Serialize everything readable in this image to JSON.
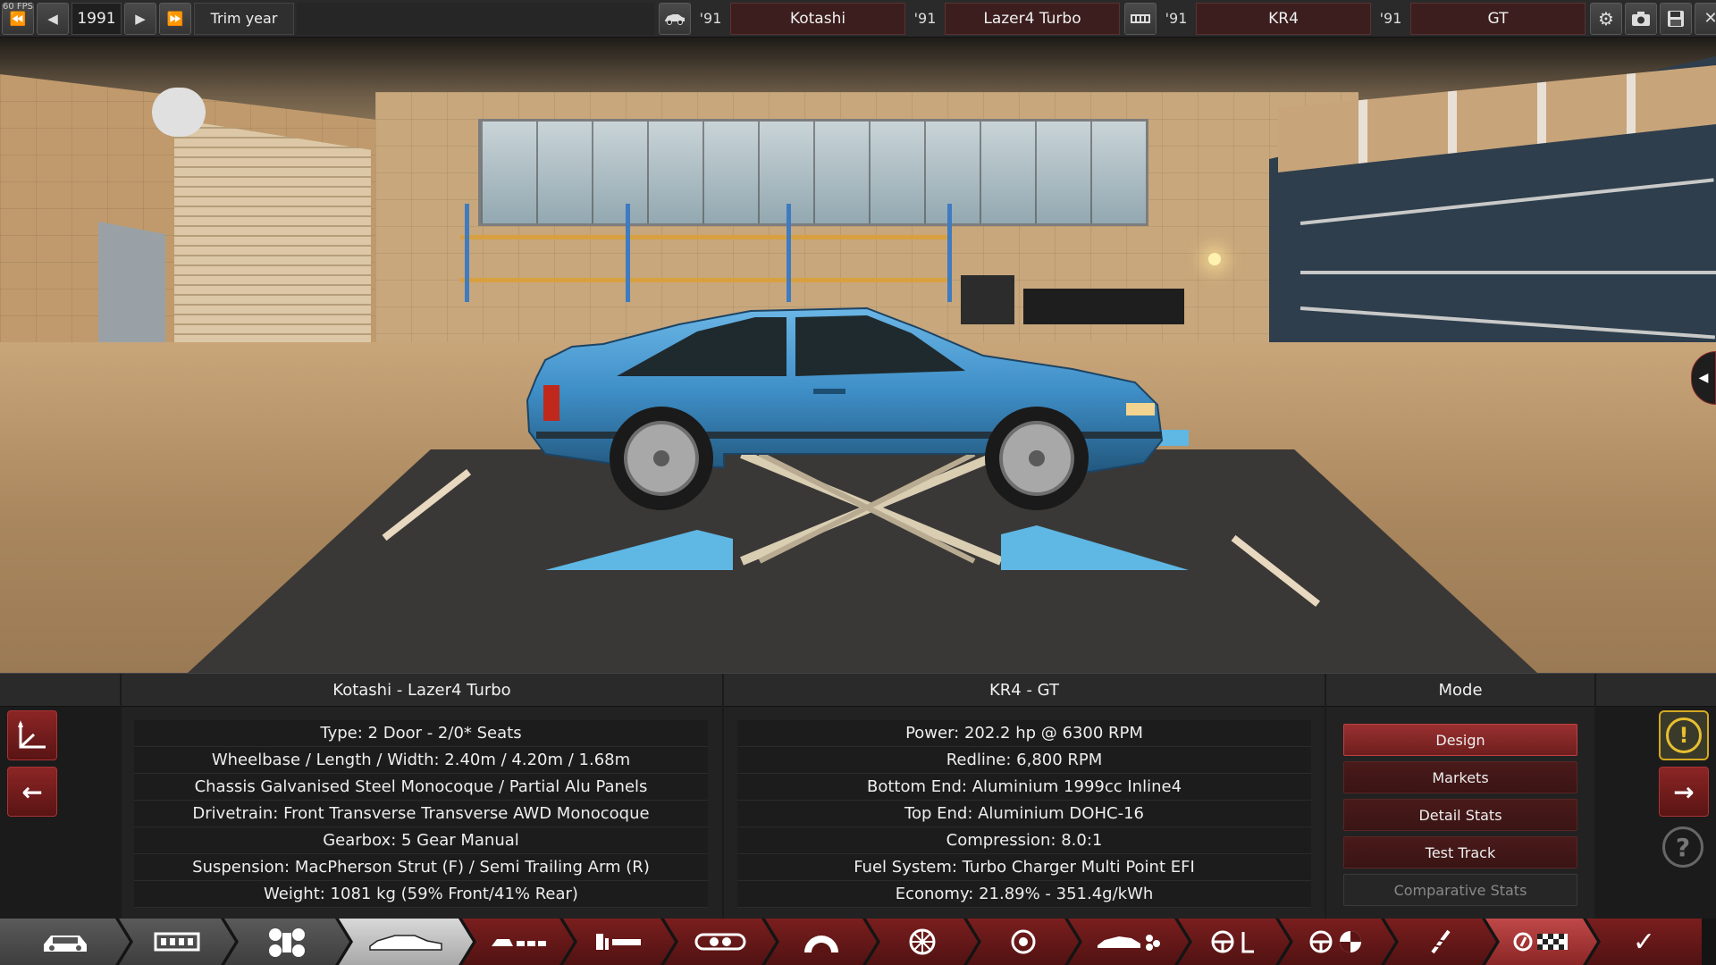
{
  "topbar": {
    "fps": "60 FPS",
    "year": "1991",
    "trim_year_label": "Trim year",
    "model_year_1": "'91",
    "model_family": "Kotashi",
    "model_year_2": "'91",
    "model_name": "Lazer4 Turbo",
    "engine_year_1": "'91",
    "engine_family": "KR4",
    "engine_year_2": "'91",
    "engine_variant": "GT"
  },
  "panel": {
    "car_header": "Kotashi - Lazer4 Turbo",
    "engine_header": "KR4 - GT",
    "mode_header": "Mode",
    "car_rows": [
      "Type: 2 Door - 2/0* Seats",
      "Wheelbase / Length / Width: 2.40m / 4.20m / 1.68m",
      "Chassis Galvanised Steel Monocoque / Partial Alu Panels",
      "Drivetrain: Front Transverse Transverse AWD Monocoque",
      "Gearbox: 5 Gear Manual",
      "Suspension: MacPherson Strut (F) / Semi Trailing Arm (R)",
      "Weight: 1081 kg (59% Front/41% Rear)"
    ],
    "engine_rows": [
      "Power: 202.2 hp @ 6300 RPM",
      "Redline:  6,800 RPM",
      "Bottom End: Aluminium 1999cc Inline4",
      "Top End: Aluminium DOHC-16",
      "Compression: 8.0:1",
      "Fuel System: Turbo Charger Multi Point EFI",
      "Economy: 21.89% - 351.4g/kWh"
    ],
    "modes": [
      "Design",
      "Markets",
      "Detail Stats",
      "Test Track",
      "Comparative Stats"
    ],
    "active_mode": "Design"
  },
  "icons": {
    "rewind": "⏪",
    "prev": "◀",
    "next": "▶",
    "fast_forward": "⏩",
    "settings": "⚙",
    "camera": "📷",
    "save": "💾",
    "close": "✕",
    "back": "←",
    "forward": "→",
    "help": "?",
    "warning": "!",
    "check": "✓",
    "panel_toggle": "◀"
  },
  "colors": {
    "accent_red": "#8c2525",
    "car_blue": "#3f8fc8",
    "lift_blue": "#5fb7e4",
    "warning_yellow": "#d4a820"
  }
}
